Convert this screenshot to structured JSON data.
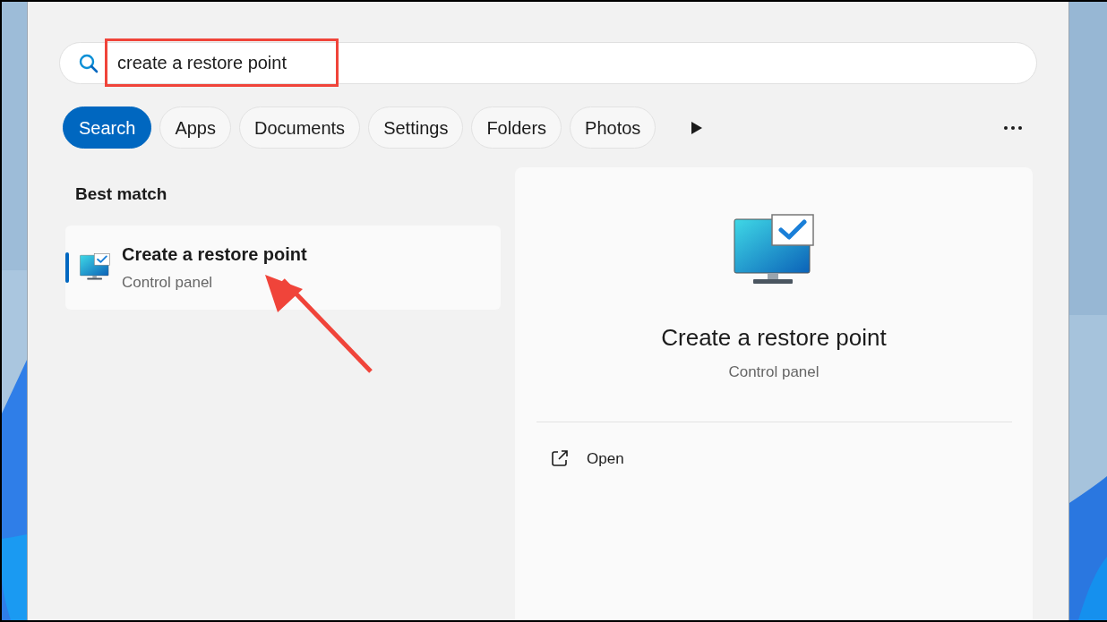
{
  "search": {
    "value": "create a restore point"
  },
  "tabs": [
    {
      "label": "Search",
      "selected": true
    },
    {
      "label": "Apps",
      "selected": false
    },
    {
      "label": "Documents",
      "selected": false
    },
    {
      "label": "Settings",
      "selected": false
    },
    {
      "label": "Folders",
      "selected": false
    },
    {
      "label": "Photos",
      "selected": false
    }
  ],
  "best_match": {
    "heading": "Best match",
    "results": [
      {
        "title": "Create a restore point",
        "subtitle": "Control panel",
        "selected": true
      }
    ]
  },
  "preview": {
    "title": "Create a restore point",
    "subtitle": "Control panel",
    "actions": [
      {
        "label": "Open"
      }
    ]
  }
}
